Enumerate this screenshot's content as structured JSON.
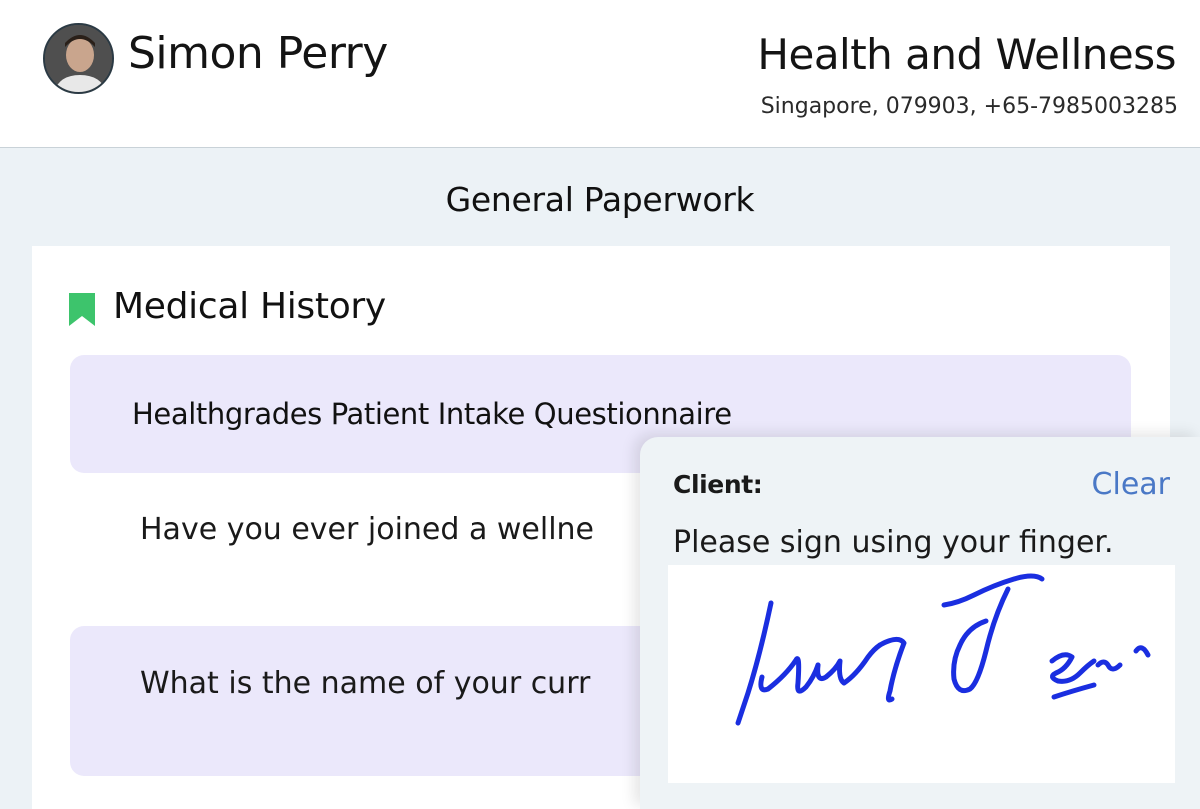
{
  "header": {
    "user_name": "Simon Perry",
    "org_name": "Health and Wellness",
    "org_address": "Singapore, 079903, +65-7985003285"
  },
  "page": {
    "section_title": "General Paperwork"
  },
  "form": {
    "heading": "Medical History",
    "heading_icon": "bookmark-icon",
    "heading_icon_color": "#3dc46c",
    "questionnaire_title": "Healthgrades Patient Intake Questionnaire",
    "questions": [
      "Have you ever joined a wellne",
      "What is the name of your curr"
    ]
  },
  "signature": {
    "label": "Client:",
    "clear_label": "Clear",
    "instruction": "Please sign using your finger.",
    "ink_color": "#1a2ee0"
  },
  "colors": {
    "accent_link": "#4a78c6",
    "question_bg": "#ebe8fb",
    "page_bg": "#ecf2f6"
  }
}
